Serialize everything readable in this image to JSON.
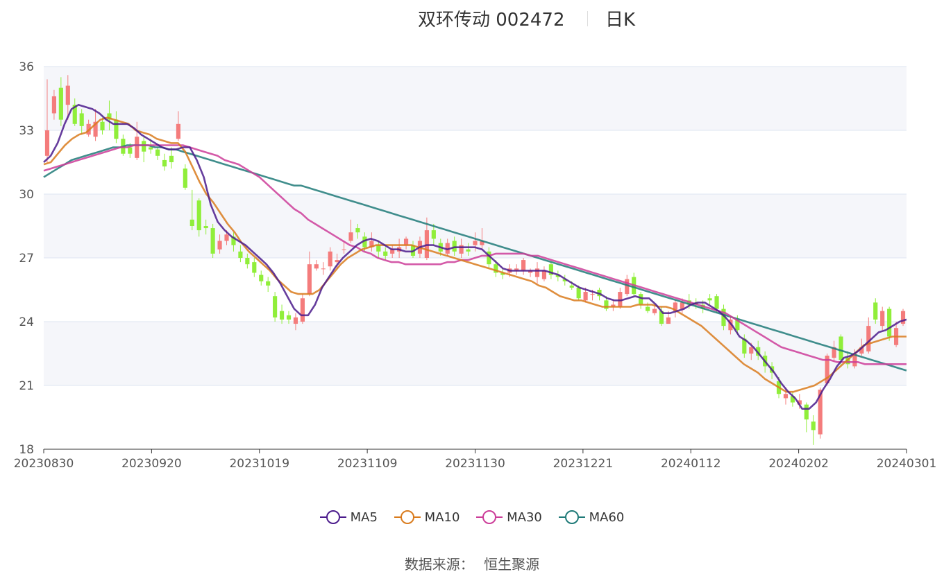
{
  "header": {
    "title": "双环传动 002472",
    "period": "日K"
  },
  "legend": [
    {
      "name": "MA5",
      "color": "#4b1b8c"
    },
    {
      "name": "MA10",
      "color": "#d97b1d"
    },
    {
      "name": "MA30",
      "color": "#cc3d99"
    },
    {
      "name": "MA60",
      "color": "#1f7a78"
    }
  ],
  "source": {
    "label": "数据来源：",
    "value": "恒生聚源"
  },
  "colors": {
    "up": "#f47c7c",
    "down": "#90ee3a",
    "grid": "#dde4f1",
    "band": "#f5f6fa"
  },
  "chart_data": {
    "type": "candlestick",
    "ylim": [
      18,
      36
    ],
    "yticks": [
      18,
      21,
      24,
      27,
      30,
      33,
      36
    ],
    "xticks": [
      "20230830",
      "20230920",
      "20231019",
      "20231109",
      "20231130",
      "20231221",
      "20240112",
      "20240202",
      "20240301"
    ],
    "candles": [
      [
        31.8,
        33.0,
        35.4,
        31.5
      ],
      [
        33.8,
        34.6,
        34.9,
        33.5
      ],
      [
        35.0,
        33.5,
        35.5,
        33.2
      ],
      [
        34.2,
        35.1,
        35.6,
        33.5
      ],
      [
        34.2,
        33.3,
        34.5,
        33.2
      ],
      [
        33.8,
        33.2,
        34.0,
        32.8
      ],
      [
        32.8,
        33.3,
        33.5,
        32.7
      ],
      [
        32.7,
        33.4,
        34.0,
        32.5
      ],
      [
        33.4,
        33.0,
        33.6,
        32.8
      ],
      [
        33.8,
        33.5,
        34.4,
        33.0
      ],
      [
        33.5,
        32.6,
        33.9,
        32.4
      ],
      [
        32.6,
        31.9,
        32.8,
        31.8
      ],
      [
        32.2,
        31.9,
        32.4,
        31.7
      ],
      [
        31.7,
        32.7,
        33.4,
        31.6
      ],
      [
        32.5,
        32.0,
        32.7,
        31.5
      ],
      [
        32.2,
        32.1,
        32.6,
        31.9
      ],
      [
        32.1,
        31.8,
        32.2,
        31.6
      ],
      [
        31.6,
        31.3,
        31.9,
        31.1
      ],
      [
        31.8,
        31.5,
        32.2,
        31.2
      ],
      [
        32.6,
        33.3,
        33.9,
        32.5
      ],
      [
        31.2,
        30.3,
        31.4,
        30.2
      ],
      [
        28.8,
        28.5,
        30.2,
        28.3
      ],
      [
        29.7,
        28.3,
        29.8,
        28.0
      ],
      [
        28.5,
        28.4,
        28.8,
        28.1
      ],
      [
        28.4,
        27.2,
        28.6,
        27.0
      ],
      [
        27.4,
        27.8,
        28.1,
        27.2
      ],
      [
        27.8,
        28.1,
        28.3,
        27.6
      ],
      [
        28.0,
        27.6,
        28.2,
        27.3
      ],
      [
        27.3,
        27.0,
        27.6,
        26.8
      ],
      [
        27.0,
        26.7,
        27.2,
        26.5
      ],
      [
        26.8,
        26.3,
        27.0,
        26.1
      ],
      [
        26.2,
        25.9,
        26.4,
        25.7
      ],
      [
        25.9,
        25.7,
        26.1,
        25.4
      ],
      [
        25.2,
        24.2,
        25.4,
        24.0
      ],
      [
        24.5,
        24.1,
        24.8,
        23.9
      ],
      [
        24.3,
        24.1,
        24.5,
        23.9
      ],
      [
        23.9,
        24.2,
        24.4,
        23.6
      ],
      [
        24.0,
        25.1,
        25.3,
        23.9
      ],
      [
        25.3,
        26.7,
        27.3,
        25.2
      ],
      [
        26.5,
        26.7,
        26.9,
        26.4
      ],
      [
        26.5,
        26.5,
        26.8,
        26.2
      ],
      [
        26.6,
        27.3,
        27.5,
        26.4
      ],
      [
        26.8,
        26.9,
        27.2,
        26.5
      ],
      [
        27.4,
        27.4,
        27.8,
        27.2
      ],
      [
        27.8,
        28.2,
        28.8,
        27.7
      ],
      [
        28.4,
        28.2,
        28.6,
        27.9
      ],
      [
        28.0,
        27.5,
        28.2,
        27.3
      ],
      [
        27.5,
        27.8,
        28.2,
        27.3
      ],
      [
        27.6,
        27.3,
        27.8,
        27.0
      ],
      [
        27.3,
        27.1,
        27.5,
        26.9
      ],
      [
        27.2,
        27.4,
        27.6,
        27.0
      ],
      [
        27.3,
        27.5,
        27.9,
        27.0
      ],
      [
        27.6,
        27.9,
        28.0,
        27.4
      ],
      [
        27.6,
        27.1,
        27.8,
        27.0
      ],
      [
        27.2,
        27.8,
        28.0,
        27.0
      ],
      [
        27.0,
        28.3,
        28.9,
        26.9
      ],
      [
        28.3,
        27.9,
        28.6,
        27.6
      ],
      [
        27.7,
        27.3,
        27.9,
        27.1
      ],
      [
        27.2,
        27.7,
        27.9,
        27.1
      ],
      [
        27.8,
        27.3,
        28.0,
        27.1
      ],
      [
        27.2,
        27.6,
        27.9,
        27.0
      ],
      [
        27.4,
        27.3,
        27.7,
        27.1
      ],
      [
        27.6,
        27.8,
        28.2,
        27.3
      ],
      [
        27.6,
        27.8,
        28.4,
        27.4
      ],
      [
        27.3,
        26.7,
        27.5,
        26.5
      ],
      [
        26.7,
        26.3,
        26.9,
        26.1
      ],
      [
        26.3,
        26.2,
        26.5,
        26.0
      ],
      [
        26.3,
        26.5,
        26.7,
        26.1
      ],
      [
        26.4,
        26.5,
        26.7,
        26.2
      ],
      [
        26.4,
        26.9,
        27.0,
        26.2
      ],
      [
        26.3,
        26.4,
        26.5,
        26.1
      ],
      [
        26.1,
        26.5,
        26.8,
        25.8
      ],
      [
        26.0,
        26.4,
        26.6,
        25.9
      ],
      [
        26.7,
        26.2,
        26.8,
        26.0
      ],
      [
        26.2,
        26.1,
        26.4,
        25.9
      ],
      [
        26.0,
        25.9,
        26.2,
        25.7
      ],
      [
        25.7,
        25.6,
        25.9,
        25.5
      ],
      [
        25.6,
        25.1,
        25.7,
        25.0
      ],
      [
        25.0,
        25.4,
        25.6,
        24.9
      ],
      [
        25.3,
        25.3,
        25.5,
        25.0
      ],
      [
        25.5,
        25.2,
        25.6,
        25.0
      ],
      [
        25.0,
        24.6,
        25.2,
        24.5
      ],
      [
        24.7,
        24.8,
        25.0,
        24.5
      ],
      [
        24.7,
        25.4,
        25.6,
        24.6
      ],
      [
        25.3,
        26.0,
        26.2,
        25.2
      ],
      [
        26.1,
        25.3,
        26.3,
        25.2
      ],
      [
        25.3,
        24.8,
        25.4,
        24.6
      ],
      [
        24.7,
        24.5,
        24.9,
        24.4
      ],
      [
        24.4,
        24.6,
        24.8,
        24.3
      ],
      [
        24.5,
        23.9,
        24.7,
        23.8
      ],
      [
        23.9,
        24.2,
        24.5,
        23.9
      ],
      [
        24.5,
        24.9,
        25.0,
        24.2
      ],
      [
        24.6,
        24.9,
        25.1,
        24.4
      ],
      [
        25.0,
        24.8,
        25.3,
        24.6
      ],
      [
        24.9,
        24.8,
        25.1,
        24.6
      ],
      [
        24.8,
        24.6,
        25.0,
        24.4
      ],
      [
        25.1,
        25.0,
        25.3,
        24.8
      ],
      [
        25.2,
        24.6,
        25.3,
        24.4
      ],
      [
        24.6,
        23.8,
        24.8,
        23.6
      ],
      [
        23.6,
        24.1,
        24.3,
        23.4
      ],
      [
        24.1,
        23.6,
        24.3,
        23.4
      ],
      [
        23.2,
        22.5,
        23.4,
        22.3
      ],
      [
        22.5,
        22.8,
        23.0,
        22.2
      ],
      [
        22.8,
        22.4,
        23.1,
        22.2
      ],
      [
        22.4,
        21.9,
        22.6,
        21.6
      ],
      [
        21.9,
        21.6,
        22.1,
        21.3
      ],
      [
        21.2,
        20.6,
        21.4,
        20.4
      ],
      [
        20.4,
        20.6,
        20.9,
        20.1
      ],
      [
        20.5,
        20.2,
        20.7,
        20.0
      ],
      [
        20.1,
        20.3,
        20.6,
        19.9
      ],
      [
        20.1,
        19.4,
        20.2,
        18.8
      ],
      [
        19.3,
        18.9,
        19.6,
        18.2
      ],
      [
        18.7,
        20.8,
        20.9,
        18.5
      ],
      [
        21.1,
        22.4,
        22.5,
        21.0
      ],
      [
        22.3,
        22.8,
        23.1,
        22.1
      ],
      [
        23.3,
        22.2,
        23.4,
        21.9
      ],
      [
        22.3,
        22.0,
        22.6,
        21.8
      ],
      [
        21.9,
        22.5,
        22.7,
        21.8
      ],
      [
        22.5,
        22.8,
        23.2,
        22.4
      ],
      [
        22.6,
        23.8,
        24.2,
        22.5
      ],
      [
        24.9,
        24.1,
        25.1,
        23.9
      ],
      [
        23.8,
        24.5,
        24.7,
        23.6
      ],
      [
        24.6,
        23.3,
        24.7,
        23.1
      ],
      [
        22.9,
        23.7,
        24.0,
        22.8
      ],
      [
        23.9,
        24.5,
        24.6,
        23.8
      ]
    ],
    "ma5": [
      31.5,
      31.8,
      32.4,
      33.3,
      34.0,
      34.2,
      34.1,
      34.0,
      33.8,
      33.5,
      33.3,
      33.3,
      33.3,
      33.1,
      32.8,
      32.6,
      32.4,
      32.2,
      32.1,
      32.1,
      32.2,
      32.2,
      31.6,
      30.8,
      29.5,
      28.7,
      28.3,
      28.0,
      27.8,
      27.6,
      27.3,
      27.0,
      26.7,
      26.3,
      25.8,
      25.2,
      24.6,
      24.3,
      24.3,
      24.8,
      25.6,
      26.1,
      26.6,
      27.0,
      27.3,
      27.6,
      27.8,
      27.9,
      27.8,
      27.6,
      27.4,
      27.4,
      27.3,
      27.3,
      27.5,
      27.6,
      27.6,
      27.5,
      27.4,
      27.5,
      27.5,
      27.5,
      27.5,
      27.4,
      27.1,
      26.8,
      26.5,
      26.4,
      26.4,
      26.4,
      26.4,
      26.4,
      26.4,
      26.3,
      26.2,
      26.0,
      25.8,
      25.6,
      25.5,
      25.4,
      25.3,
      25.1,
      25.0,
      25.0,
      25.1,
      25.2,
      25.1,
      25.1,
      24.8,
      24.4,
      24.4,
      24.5,
      24.6,
      24.8,
      24.9,
      24.9,
      24.7,
      24.5,
      24.2,
      23.8,
      23.3,
      23.1,
      22.8,
      22.4,
      22.0,
      21.6,
      21.1,
      20.7,
      20.4,
      19.9,
      19.9,
      20.2,
      20.8,
      21.3,
      21.9,
      22.3,
      22.4,
      22.6,
      22.9,
      23.2,
      23.5,
      23.6,
      23.8,
      24.0,
      24.1
    ],
    "ma10": [
      31.4,
      31.5,
      31.9,
      32.3,
      32.6,
      32.8,
      32.9,
      33.2,
      33.5,
      33.6,
      33.5,
      33.4,
      33.3,
      33.0,
      32.9,
      32.8,
      32.6,
      32.5,
      32.4,
      32.4,
      32.0,
      31.3,
      30.6,
      30.0,
      29.6,
      29.1,
      28.6,
      28.2,
      27.7,
      27.3,
      27.0,
      26.7,
      26.4,
      26.0,
      25.7,
      25.4,
      25.3,
      25.3,
      25.3,
      25.5,
      25.9,
      26.3,
      26.7,
      27.0,
      27.2,
      27.4,
      27.5,
      27.6,
      27.6,
      27.6,
      27.6,
      27.6,
      27.6,
      27.5,
      27.4,
      27.3,
      27.2,
      27.1,
      27.0,
      26.9,
      26.8,
      26.7,
      26.6,
      26.5,
      26.4,
      26.3,
      26.2,
      26.1,
      26.0,
      25.9,
      25.7,
      25.6,
      25.4,
      25.2,
      25.1,
      25.0,
      25.0,
      24.9,
      24.8,
      24.7,
      24.7,
      24.7,
      24.7,
      24.7,
      24.8,
      24.8,
      24.8,
      24.7,
      24.7,
      24.6,
      24.4,
      24.2,
      24.0,
      23.8,
      23.5,
      23.2,
      22.9,
      22.6,
      22.3,
      22.0,
      21.8,
      21.6,
      21.3,
      21.1,
      20.9,
      20.7,
      20.7,
      20.8,
      20.9,
      21.0,
      21.2,
      21.4,
      21.7,
      22.0,
      22.3,
      22.6,
      22.9,
      23.0,
      23.1,
      23.2,
      23.3,
      23.3,
      23.3
    ],
    "ma30": [
      31.1,
      31.2,
      31.3,
      31.4,
      31.5,
      31.6,
      31.7,
      31.8,
      31.9,
      32.0,
      32.1,
      32.2,
      32.2,
      32.3,
      32.3,
      32.3,
      32.3,
      32.3,
      32.3,
      32.3,
      32.3,
      32.2,
      32.1,
      32.0,
      31.9,
      31.8,
      31.6,
      31.5,
      31.4,
      31.2,
      31.0,
      30.8,
      30.5,
      30.2,
      29.9,
      29.6,
      29.3,
      29.1,
      28.8,
      28.6,
      28.4,
      28.2,
      28.0,
      27.8,
      27.6,
      27.5,
      27.3,
      27.2,
      27.0,
      26.9,
      26.8,
      26.8,
      26.7,
      26.7,
      26.7,
      26.7,
      26.7,
      26.7,
      26.8,
      26.8,
      26.9,
      26.9,
      27.0,
      27.1,
      27.1,
      27.2,
      27.2,
      27.2,
      27.2,
      27.2,
      27.1,
      27.1,
      27.0,
      26.9,
      26.8,
      26.7,
      26.6,
      26.5,
      26.4,
      26.3,
      26.2,
      26.1,
      26.0,
      25.9,
      25.8,
      25.7,
      25.6,
      25.5,
      25.4,
      25.3,
      25.2,
      25.1,
      25.0,
      24.9,
      24.8,
      24.7,
      24.6,
      24.5,
      24.4,
      24.2,
      24.0,
      23.8,
      23.6,
      23.4,
      23.2,
      23.0,
      22.8,
      22.7,
      22.6,
      22.5,
      22.4,
      22.3,
      22.2,
      22.2,
      22.1,
      22.1,
      22.1,
      22.1,
      22.0,
      22.0,
      22.0,
      22.0,
      22.0,
      22.0,
      22.0
    ],
    "ma60": [
      30.8,
      31.0,
      31.2,
      31.4,
      31.6,
      31.7,
      31.8,
      31.9,
      32.0,
      32.1,
      32.2,
      32.2,
      32.3,
      32.3,
      32.3,
      32.3,
      32.2,
      32.2,
      32.1,
      32.1,
      32.0,
      31.9,
      31.8,
      31.7,
      31.6,
      31.5,
      31.4,
      31.3,
      31.2,
      31.1,
      31.0,
      30.9,
      30.8,
      30.7,
      30.6,
      30.5,
      30.4,
      30.4,
      30.3,
      30.2,
      30.1,
      30.0,
      29.9,
      29.8,
      29.7,
      29.6,
      29.5,
      29.4,
      29.3,
      29.2,
      29.1,
      29.0,
      28.9,
      28.8,
      28.7,
      28.6,
      28.5,
      28.4,
      28.3,
      28.2,
      28.1,
      28.0,
      27.9,
      27.8,
      27.7,
      27.6,
      27.5,
      27.4,
      27.3,
      27.2,
      27.1,
      27.0,
      26.9,
      26.8,
      26.7,
      26.6,
      26.5,
      26.4,
      26.3,
      26.2,
      26.1,
      26.0,
      25.9,
      25.8,
      25.7,
      25.6,
      25.5,
      25.4,
      25.3,
      25.2,
      25.1,
      25.0,
      24.9,
      24.8,
      24.7,
      24.6,
      24.5,
      24.4,
      24.3,
      24.2,
      24.1,
      24.0,
      23.9,
      23.8,
      23.7,
      23.6,
      23.5,
      23.4,
      23.3,
      23.2,
      23.1,
      23.0,
      22.9,
      22.8,
      22.7,
      22.6,
      22.5,
      22.4,
      22.3,
      22.2,
      22.1,
      22.0,
      21.9,
      21.8,
      21.7
    ]
  }
}
